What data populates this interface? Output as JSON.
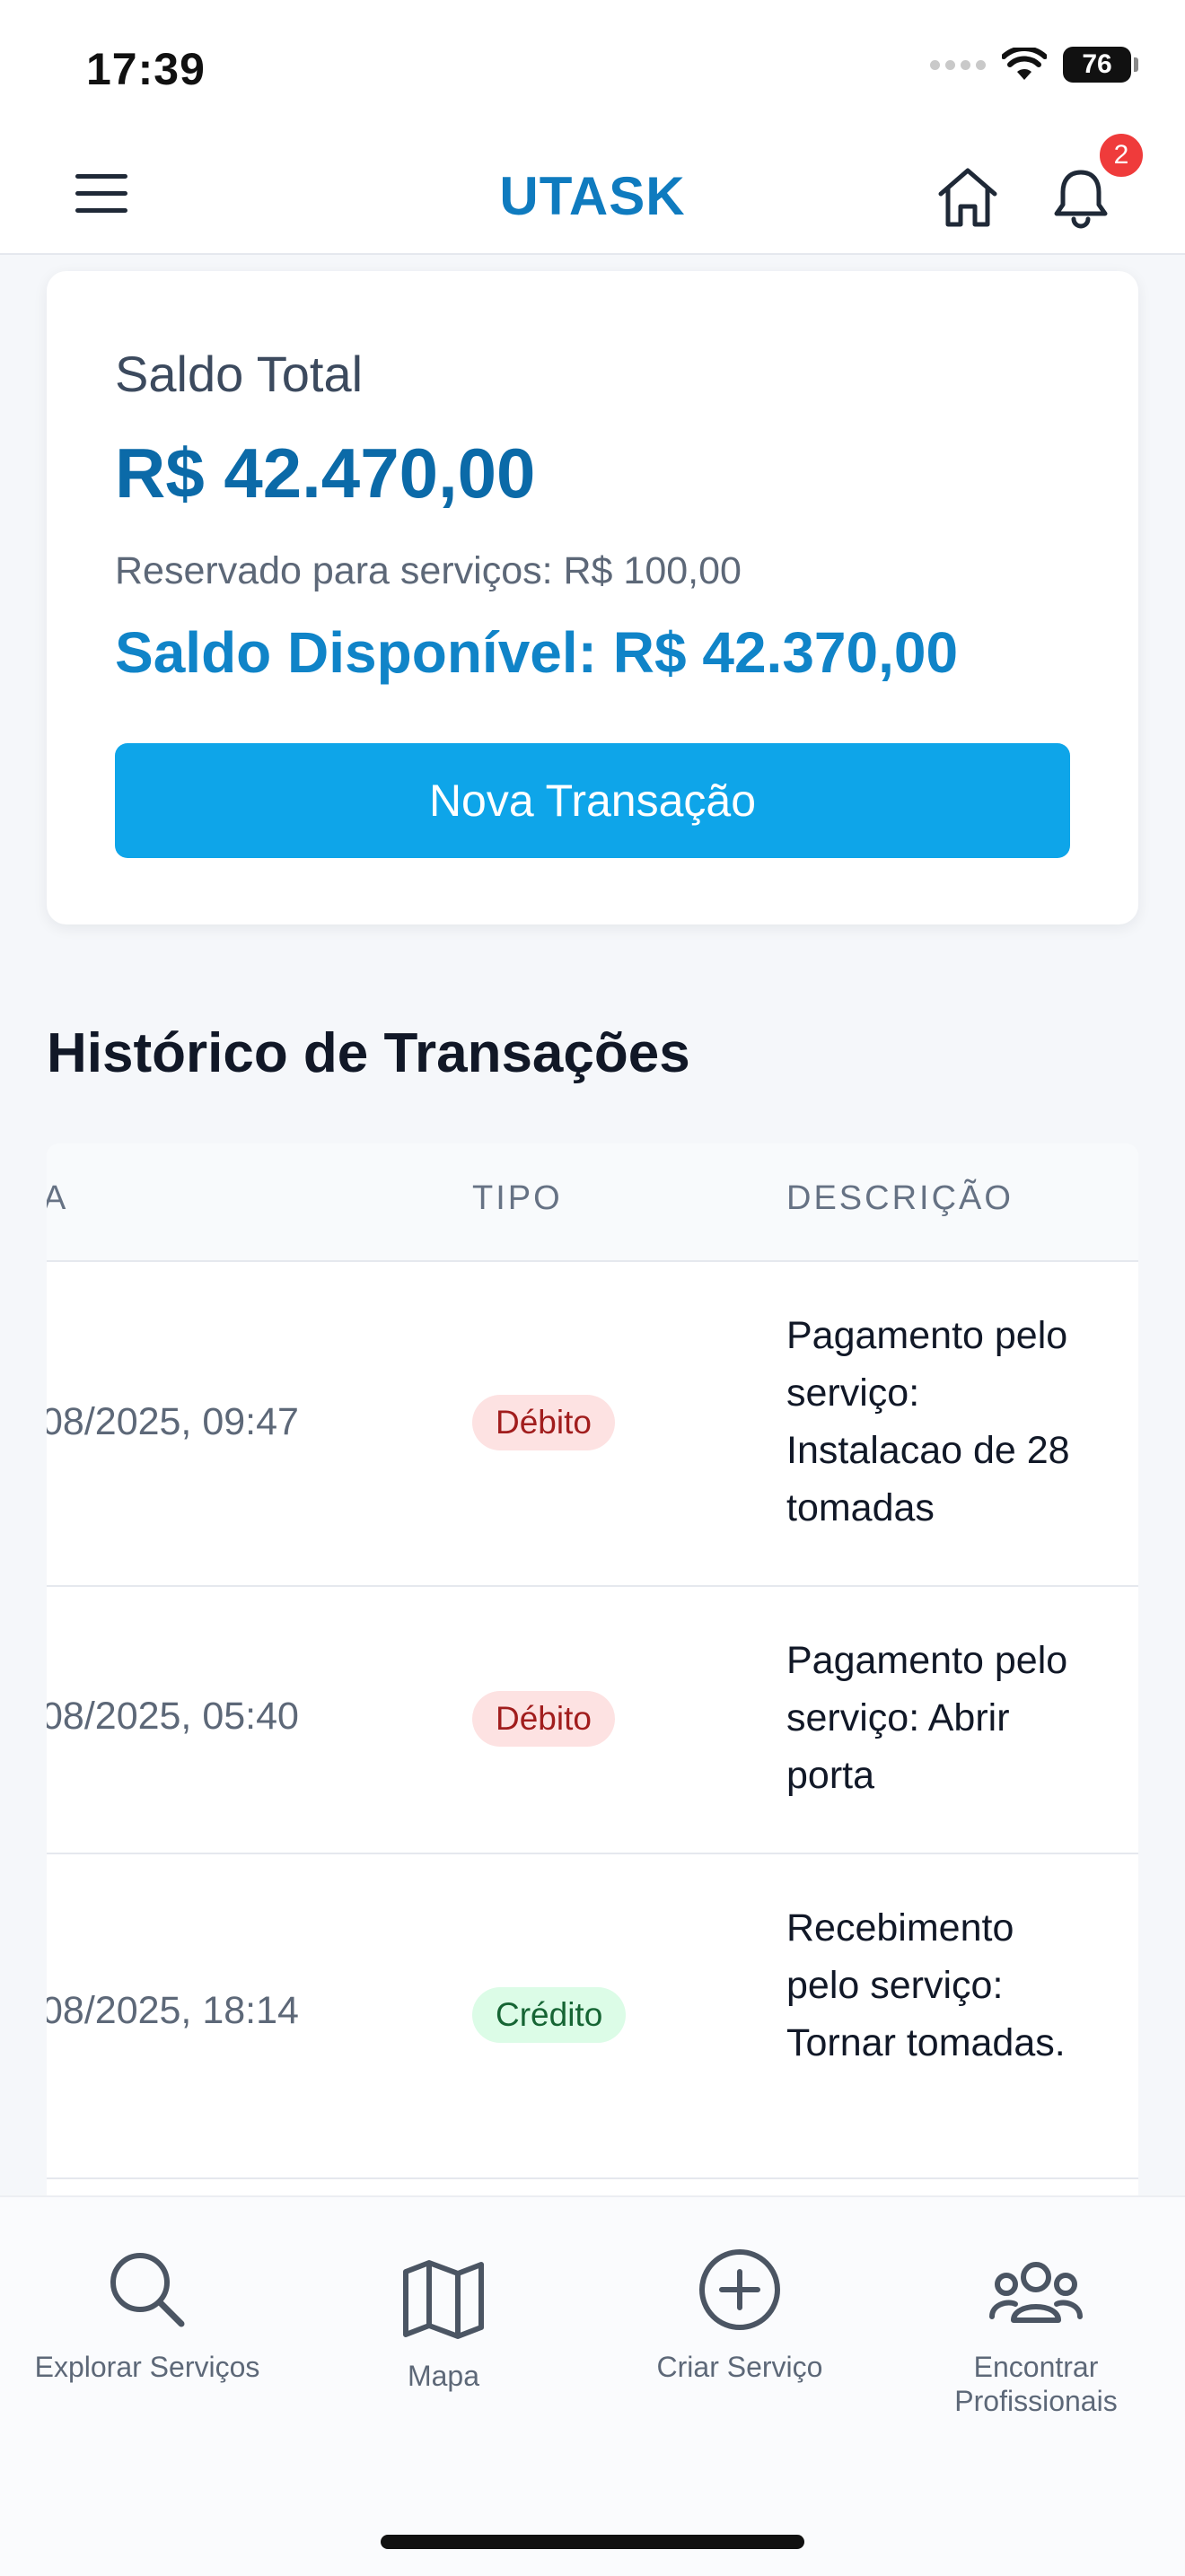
{
  "status_bar": {
    "time": "17:39",
    "battery": "76"
  },
  "header": {
    "title": "UTASK",
    "notification_count": "2"
  },
  "balance": {
    "label": "Saldo Total",
    "total": "R$ 42.470,00",
    "reserved": "Reservado para serviços: R$ 100,00",
    "available": "Saldo Disponível: R$ 42.370,00",
    "button_label": "Nova Transação"
  },
  "history": {
    "title": "Histórico de Transações",
    "columns": {
      "date": "A",
      "type": "TIPO",
      "description": "DESCRIÇÃO"
    },
    "rows": [
      {
        "date": "08/2025, 09:47",
        "type": "Débito",
        "description": "Pagamento pelo serviço: Instalacao de 28 tomadas"
      },
      {
        "date": "08/2025, 05:40",
        "type": "Débito",
        "description": "Pagamento pelo serviço: Abrir porta"
      },
      {
        "date": "08/2025, 18:14",
        "type": "Crédito",
        "description": "Recebimento pelo serviço: Tornar tomadas."
      }
    ]
  },
  "bottom_nav": {
    "items": [
      {
        "label": "Explorar Serviços",
        "icon": "search-icon"
      },
      {
        "label": "Mapa",
        "icon": "map-icon"
      },
      {
        "label": "Criar Serviço",
        "icon": "plus-circle-icon"
      },
      {
        "label": "Encontrar Profissionais",
        "icon": "users-icon"
      }
    ]
  },
  "colors": {
    "brand": "#0f7bbf",
    "button": "#0ea5e9",
    "debit_bg": "#fde2e2",
    "credit_bg": "#dcfce7",
    "badge": "#ef3b3b"
  }
}
